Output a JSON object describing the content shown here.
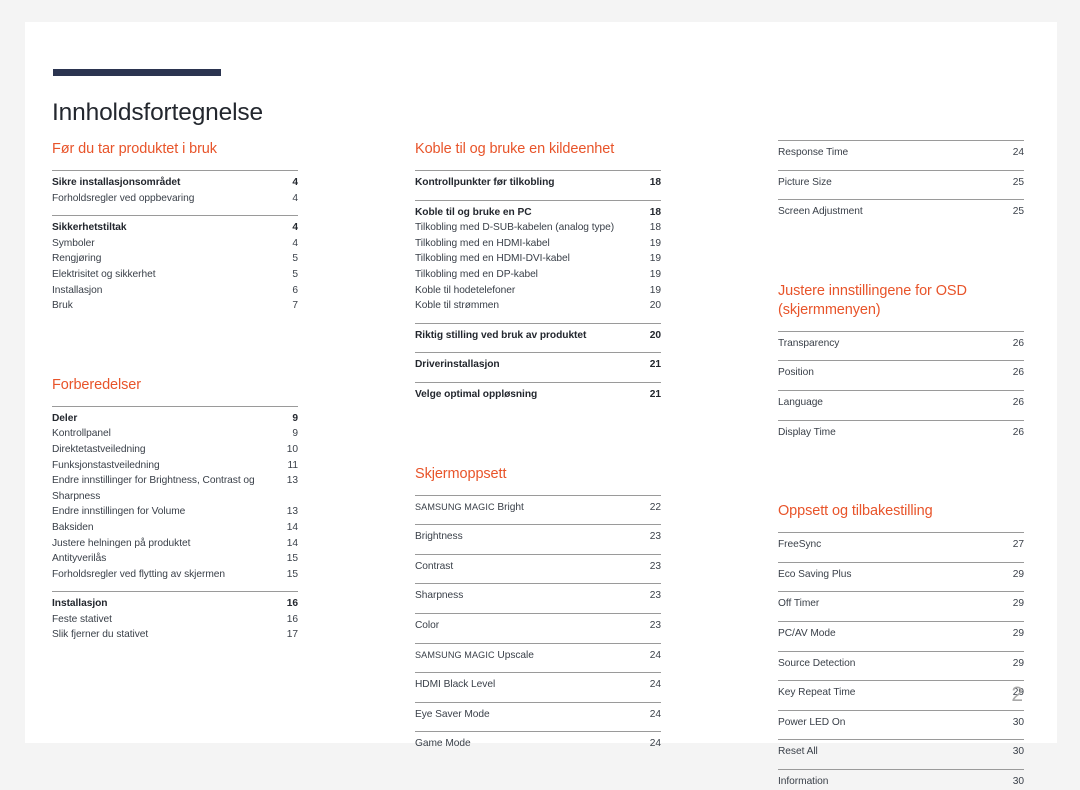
{
  "document": {
    "title": "Innholdsfortegnelse",
    "page_number": "2",
    "accent_color": "#e8542a",
    "rule_color": "#2b3450",
    "text_color": "#3a4049",
    "page_number_color": "#a9a9a9"
  },
  "columns": [
    {
      "sections": [
        {
          "heading": "Før du tar produktet i bruk",
          "groups": [
            {
              "entries": [
                {
                  "label": "Sikre installasjonsområdet",
                  "page": "4",
                  "bold": true
                },
                {
                  "label": "Forholdsregler ved oppbevaring",
                  "page": "4",
                  "bold": false
                }
              ]
            },
            {
              "entries": [
                {
                  "label": "Sikkerhetstiltak",
                  "page": "4",
                  "bold": true
                },
                {
                  "label": "Symboler",
                  "page": "4",
                  "bold": false
                },
                {
                  "label": "Rengjøring",
                  "page": "5",
                  "bold": false
                },
                {
                  "label": "Elektrisitet og sikkerhet",
                  "page": "5",
                  "bold": false
                },
                {
                  "label": "Installasjon",
                  "page": "6",
                  "bold": false
                },
                {
                  "label": "Bruk",
                  "page": "7",
                  "bold": false
                }
              ]
            }
          ]
        },
        {
          "heading": "Forberedelser",
          "groups": [
            {
              "entries": [
                {
                  "label": "Deler",
                  "page": "9",
                  "bold": true
                },
                {
                  "label": "Kontrollpanel",
                  "page": "9",
                  "bold": false
                },
                {
                  "label": "Direktetastveiledning",
                  "page": "10",
                  "bold": false
                },
                {
                  "label": "Funksjonstastveiledning",
                  "page": "11",
                  "bold": false
                },
                {
                  "label": "Endre innstillinger for Brightness, Contrast og Sharpness",
                  "page": "13",
                  "bold": false,
                  "wrap": true
                },
                {
                  "label": "Endre innstillingen for Volume",
                  "page": "13",
                  "bold": false
                },
                {
                  "label": "Baksiden",
                  "page": "14",
                  "bold": false
                },
                {
                  "label": "Justere helningen på produktet",
                  "page": "14",
                  "bold": false
                },
                {
                  "label": "Antityverilås",
                  "page": "15",
                  "bold": false
                },
                {
                  "label": "Forholdsregler ved flytting av skjermen",
                  "page": "15",
                  "bold": false
                }
              ]
            },
            {
              "entries": [
                {
                  "label": "Installasjon",
                  "page": "16",
                  "bold": true
                },
                {
                  "label": "Feste stativet",
                  "page": "16",
                  "bold": false
                },
                {
                  "label": "Slik fjerner du stativet",
                  "page": "17",
                  "bold": false
                }
              ]
            }
          ]
        }
      ]
    },
    {
      "sections": [
        {
          "heading": "Koble til og bruke en kildeenhet",
          "groups": [
            {
              "entries": [
                {
                  "label": "Kontrollpunkter før tilkobling",
                  "page": "18",
                  "bold": true
                }
              ]
            },
            {
              "entries": [
                {
                  "label": "Koble til og bruke en PC",
                  "page": "18",
                  "bold": true
                },
                {
                  "label": "Tilkobling med D-SUB-kabelen (analog type)",
                  "page": "18",
                  "bold": false
                },
                {
                  "label": "Tilkobling med en HDMI-kabel",
                  "page": "19",
                  "bold": false
                },
                {
                  "label": "Tilkobling med en HDMI-DVI-kabel",
                  "page": "19",
                  "bold": false
                },
                {
                  "label": "Tilkobling med en DP-kabel",
                  "page": "19",
                  "bold": false
                },
                {
                  "label": "Koble til hodetelefoner",
                  "page": "19",
                  "bold": false
                },
                {
                  "label": "Koble til strømmen",
                  "page": "20",
                  "bold": false
                }
              ]
            },
            {
              "entries": [
                {
                  "label": "Riktig stilling ved bruk av produktet",
                  "page": "20",
                  "bold": true
                }
              ]
            },
            {
              "entries": [
                {
                  "label": "Driverinstallasjon",
                  "page": "21",
                  "bold": true
                }
              ]
            },
            {
              "entries": [
                {
                  "label": "Velge optimal oppløsning",
                  "page": "21",
                  "bold": true
                }
              ]
            }
          ]
        },
        {
          "heading": "Skjermoppsett",
          "groups": [
            {
              "entries": [
                {
                  "label": "SAMSUNG MAGIC Bright",
                  "page": "22",
                  "bold": false,
                  "smallcaps_prefix": "SAMSUNG MAGIC",
                  "rest": " Bright"
                }
              ]
            },
            {
              "entries": [
                {
                  "label": "Brightness",
                  "page": "23",
                  "bold": false
                }
              ]
            },
            {
              "entries": [
                {
                  "label": "Contrast",
                  "page": "23",
                  "bold": false
                }
              ]
            },
            {
              "entries": [
                {
                  "label": "Sharpness",
                  "page": "23",
                  "bold": false
                }
              ]
            },
            {
              "entries": [
                {
                  "label": "Color",
                  "page": "23",
                  "bold": false
                }
              ]
            },
            {
              "entries": [
                {
                  "label": "SAMSUNG MAGIC Upscale",
                  "page": "24",
                  "bold": false,
                  "smallcaps_prefix": "SAMSUNG MAGIC",
                  "rest": " Upscale"
                }
              ]
            },
            {
              "entries": [
                {
                  "label": "HDMI Black Level",
                  "page": "24",
                  "bold": false
                }
              ]
            },
            {
              "entries": [
                {
                  "label": "Eye Saver Mode",
                  "page": "24",
                  "bold": false
                }
              ]
            },
            {
              "entries": [
                {
                  "label": "Game Mode",
                  "page": "24",
                  "bold": false
                }
              ]
            }
          ]
        }
      ]
    },
    {
      "sections": [
        {
          "heading": "",
          "groups": [
            {
              "entries": [
                {
                  "label": "Response Time",
                  "page": "24",
                  "bold": false
                }
              ]
            },
            {
              "entries": [
                {
                  "label": "Picture Size",
                  "page": "25",
                  "bold": false
                }
              ]
            },
            {
              "entries": [
                {
                  "label": "Screen Adjustment",
                  "page": "25",
                  "bold": false
                }
              ]
            }
          ]
        },
        {
          "heading": "Justere innstillingene for OSD (skjermmenyen)",
          "groups": [
            {
              "entries": [
                {
                  "label": "Transparency",
                  "page": "26",
                  "bold": false
                }
              ]
            },
            {
              "entries": [
                {
                  "label": "Position",
                  "page": "26",
                  "bold": false
                }
              ]
            },
            {
              "entries": [
                {
                  "label": "Language",
                  "page": "26",
                  "bold": false
                }
              ]
            },
            {
              "entries": [
                {
                  "label": "Display Time",
                  "page": "26",
                  "bold": false
                }
              ]
            }
          ]
        },
        {
          "heading": "Oppsett og tilbakestilling",
          "groups": [
            {
              "entries": [
                {
                  "label": "FreeSync",
                  "page": "27",
                  "bold": false
                }
              ]
            },
            {
              "entries": [
                {
                  "label": "Eco Saving Plus",
                  "page": "29",
                  "bold": false
                }
              ]
            },
            {
              "entries": [
                {
                  "label": "Off Timer",
                  "page": "29",
                  "bold": false
                }
              ]
            },
            {
              "entries": [
                {
                  "label": "PC/AV Mode",
                  "page": "29",
                  "bold": false
                }
              ]
            },
            {
              "entries": [
                {
                  "label": "Source Detection",
                  "page": "29",
                  "bold": false
                }
              ]
            },
            {
              "entries": [
                {
                  "label": "Key Repeat Time",
                  "page": "29",
                  "bold": false
                }
              ]
            },
            {
              "entries": [
                {
                  "label": "Power LED On",
                  "page": "30",
                  "bold": false
                }
              ]
            },
            {
              "entries": [
                {
                  "label": "Reset All",
                  "page": "30",
                  "bold": false
                }
              ]
            },
            {
              "entries": [
                {
                  "label": "Information",
                  "page": "30",
                  "bold": false
                }
              ]
            }
          ]
        }
      ]
    }
  ]
}
